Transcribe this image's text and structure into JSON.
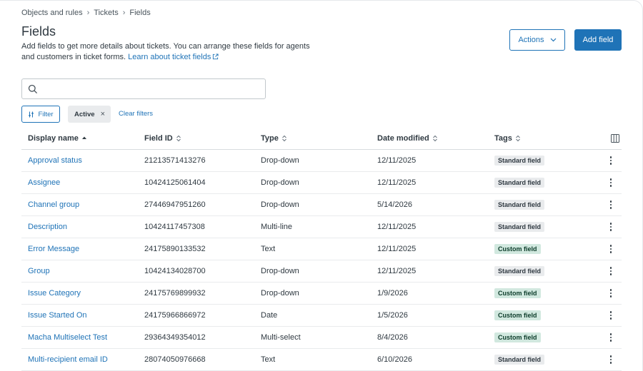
{
  "breadcrumb": [
    "Objects and rules",
    "Tickets",
    "Fields"
  ],
  "page_title": "Fields",
  "description": {
    "text": "Add fields to get more details about tickets. You can arrange these fields for agents and customers in ticket forms.",
    "link": "Learn about ticket fields"
  },
  "actions_label": "Actions",
  "add_field_label": "Add field",
  "search": {
    "placeholder": "",
    "value": ""
  },
  "filter_label": "Filter",
  "active_chip": "Active",
  "clear_filters": "Clear filters",
  "columns": [
    "Display name",
    "Field ID",
    "Type",
    "Date modified",
    "Tags"
  ],
  "rows": [
    {
      "name": "Approval status",
      "id": "21213571413276",
      "type": "Drop-down",
      "date": "12/11/2025",
      "tag": "Standard field",
      "tag_kind": "standard"
    },
    {
      "name": "Assignee",
      "id": "10424125061404",
      "type": "Drop-down",
      "date": "12/11/2025",
      "tag": "Standard field",
      "tag_kind": "standard"
    },
    {
      "name": "Channel group",
      "id": "27446947951260",
      "type": "Drop-down",
      "date": "5/14/2026",
      "tag": "Standard field",
      "tag_kind": "standard"
    },
    {
      "name": "Description",
      "id": "10424117457308",
      "type": "Multi-line",
      "date": "12/11/2025",
      "tag": "Standard field",
      "tag_kind": "standard"
    },
    {
      "name": "Error Message",
      "id": "24175890133532",
      "type": "Text",
      "date": "12/11/2025",
      "tag": "Custom field",
      "tag_kind": "custom"
    },
    {
      "name": "Group",
      "id": "10424134028700",
      "type": "Drop-down",
      "date": "12/11/2025",
      "tag": "Standard field",
      "tag_kind": "standard"
    },
    {
      "name": "Issue Category",
      "id": "24175769899932",
      "type": "Drop-down",
      "date": "1/9/2026",
      "tag": "Custom field",
      "tag_kind": "custom"
    },
    {
      "name": "Issue Started On",
      "id": "24175966866972",
      "type": "Date",
      "date": "1/5/2026",
      "tag": "Custom field",
      "tag_kind": "custom"
    },
    {
      "name": "Macha Multiselect Test",
      "id": "29364349354012",
      "type": "Multi-select",
      "date": "8/4/2026",
      "tag": "Custom field",
      "tag_kind": "custom"
    },
    {
      "name": "Multi-recipient email ID",
      "id": "28074050976668",
      "type": "Text",
      "date": "6/10/2026",
      "tag": "Standard field",
      "tag_kind": "standard"
    }
  ],
  "colors": {
    "accent": "#1f73b7",
    "custom_tag_bg": "#d1e8df",
    "standard_tag_bg": "#e9ebed"
  }
}
